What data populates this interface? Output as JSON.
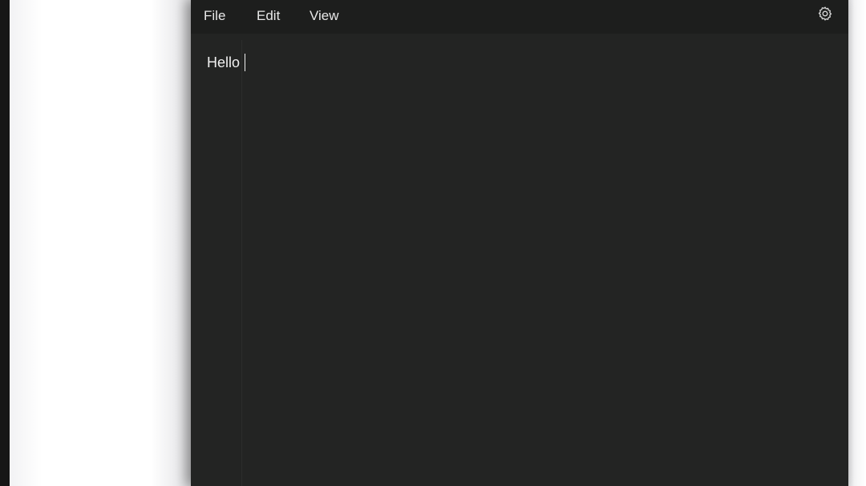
{
  "menubar": {
    "file_label": "File",
    "edit_label": "Edit",
    "view_label": "View",
    "settings_icon": "gear-icon"
  },
  "editor": {
    "content": "Hello"
  },
  "colors": {
    "window_bg": "#232423",
    "menubar_bg": "#1d1e1d",
    "text": "#f0f0f0"
  }
}
